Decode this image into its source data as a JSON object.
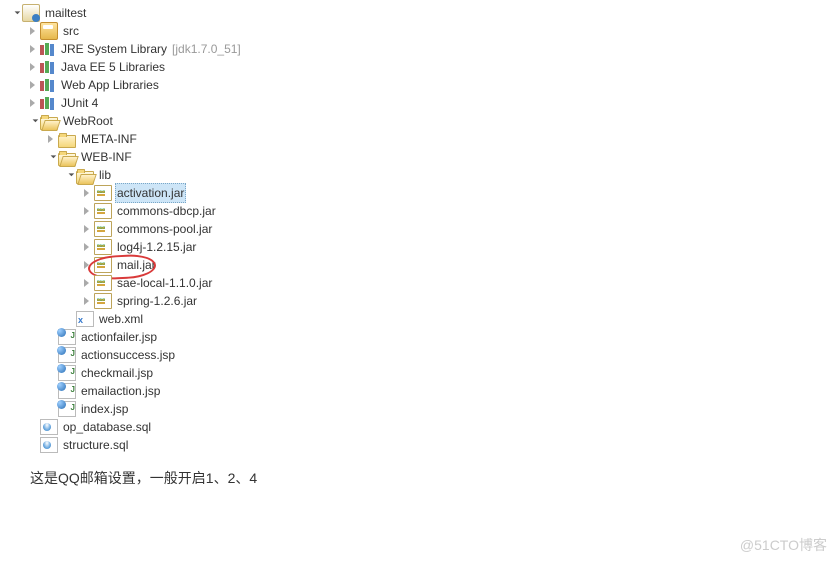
{
  "tree": {
    "project": "mailtest",
    "src": "src",
    "jre": {
      "label": "JRE System Library",
      "qualifier": "[jdk1.7.0_51]"
    },
    "jee": "Java EE 5 Libraries",
    "webapplib": "Web App Libraries",
    "junit": "JUnit 4",
    "webroot": "WebRoot",
    "metainf": "META-INF",
    "webinf": "WEB-INF",
    "lib": "lib",
    "jars": [
      "activation.jar",
      "commons-dbcp.jar",
      "commons-pool.jar",
      "log4j-1.2.15.jar",
      "mail.jar",
      "sae-local-1.1.0.jar",
      "spring-1.2.6.jar"
    ],
    "webxml": "web.xml",
    "jsps": [
      "actionfailer.jsp",
      "actionsuccess.jsp",
      "checkmail.jsp",
      "emailaction.jsp",
      "index.jsp"
    ],
    "sqls": [
      "op_database.sql",
      "structure.sql"
    ]
  },
  "selected_jar_index": 0,
  "circled_jar_index": 4,
  "caption": "这是QQ邮箱设置，一般开启1、2、4",
  "watermark": "@51CTO博客"
}
